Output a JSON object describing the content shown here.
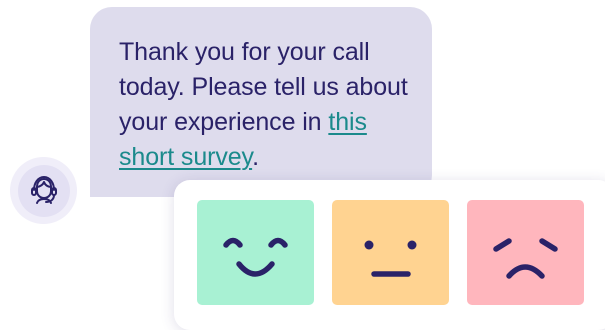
{
  "message": {
    "text_before_link": "Thank you for your call today. Please tell us about your experience in ",
    "link_text": "this short survey",
    "text_after_link": "."
  },
  "avatar": {
    "icon": "headset-agent-icon"
  },
  "rating": {
    "options": [
      {
        "icon": "happy-face-icon",
        "color": "#a8f1d3"
      },
      {
        "icon": "neutral-face-icon",
        "color": "#ffd391"
      },
      {
        "icon": "sad-face-icon",
        "color": "#ffb6bd"
      }
    ]
  },
  "colors": {
    "bubble_background": "#dedced",
    "text": "#2a2268",
    "link": "#1b8a8c",
    "avatar_background": "#e3e0f3"
  }
}
